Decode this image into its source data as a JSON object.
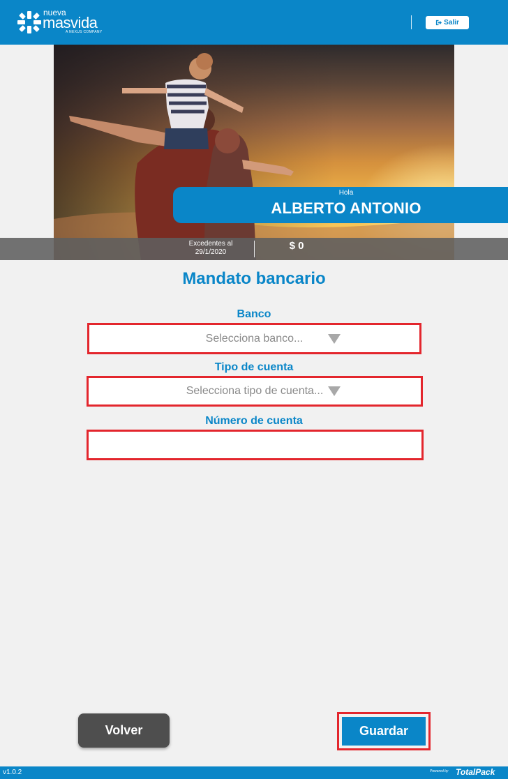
{
  "header": {
    "logo_top": "nueva",
    "logo_main": "masvida",
    "logo_sub": "A NEXUS COMPANY",
    "logout_label": "Salir",
    "logout_icon": "sign-out-icon"
  },
  "hero": {
    "greeting": "Hola",
    "user_name": "ALBERTO ANTONIO",
    "balance_label_line1": "Excedentes al",
    "balance_label_line2": "29/1/2020",
    "balance_value": "$ 0"
  },
  "form": {
    "title": "Mandato bancario",
    "bank_label": "Banco",
    "bank_placeholder": "Selecciona banco...",
    "account_type_label": "Tipo de cuenta",
    "account_type_placeholder": "Selecciona tipo de cuenta...",
    "account_number_label": "Número de cuenta",
    "account_number_value": ""
  },
  "actions": {
    "back_label": "Volver",
    "save_label": "Guardar"
  },
  "footer": {
    "version": "v1.0.2",
    "powered_by": "Powered by",
    "brand": "TotalPack"
  },
  "colors": {
    "brand_blue": "#0a86c8",
    "highlight_red": "#e3262d",
    "back_button": "#4e4e4e",
    "background": "#f1f1f1"
  }
}
